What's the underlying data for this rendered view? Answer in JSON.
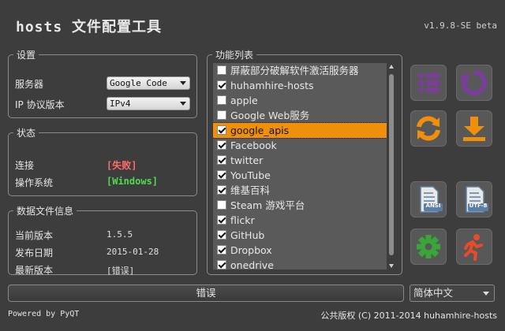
{
  "app": {
    "title": "hosts 文件配置工具",
    "version": "v1.9.8-SE beta"
  },
  "settings": {
    "legend": "设置",
    "server_label": "服务器",
    "server_value": "Google Code",
    "ip_label": "IP 协议版本",
    "ip_value": "IPv4"
  },
  "status": {
    "legend": "状态",
    "conn_label": "连接",
    "conn_value": "[失败]",
    "os_label": "操作系统",
    "os_value": "[Windows]"
  },
  "datafile": {
    "legend": "数据文件信息",
    "cur_label": "当前版本",
    "cur_value": "1.5.5",
    "date_label": "发布日期",
    "date_value": "2015-01-28",
    "latest_label": "最新版本",
    "latest_value": "[错误]"
  },
  "features": {
    "legend": "功能列表",
    "items": [
      {
        "label": "屏蔽部分破解软件激活服务器",
        "checked": false
      },
      {
        "label": "huhamhire-hosts",
        "checked": true
      },
      {
        "label": "apple",
        "checked": false
      },
      {
        "label": "Google Web服务",
        "checked": false
      },
      {
        "label": "google_apis",
        "checked": true
      },
      {
        "label": "Facebook",
        "checked": true
      },
      {
        "label": "twitter",
        "checked": true
      },
      {
        "label": "YouTube",
        "checked": true
      },
      {
        "label": "维基百科",
        "checked": true
      },
      {
        "label": "Steam 游戏平台",
        "checked": false
      },
      {
        "label": "flickr",
        "checked": true
      },
      {
        "label": "GitHub",
        "checked": true
      },
      {
        "label": "Dropbox",
        "checked": true
      },
      {
        "label": "onedrive",
        "checked": true
      }
    ],
    "selected_index": 4
  },
  "buttons": {
    "ansi_label": "ANSI",
    "utf8_label": "UTF-8"
  },
  "statusbar": {
    "text": "错误"
  },
  "language": {
    "value": "简体中文"
  },
  "footer": {
    "left": "Powered by PyQT",
    "right": "公共版权 (C) 2011-2014 huhamhire-hosts"
  },
  "colors": {
    "accent": "#7a3d9a",
    "orange": "#f0900a",
    "green": "#3aa53a",
    "red": "#e84b2a",
    "error": "#ff6b6b",
    "ok": "#4fdc4f"
  }
}
